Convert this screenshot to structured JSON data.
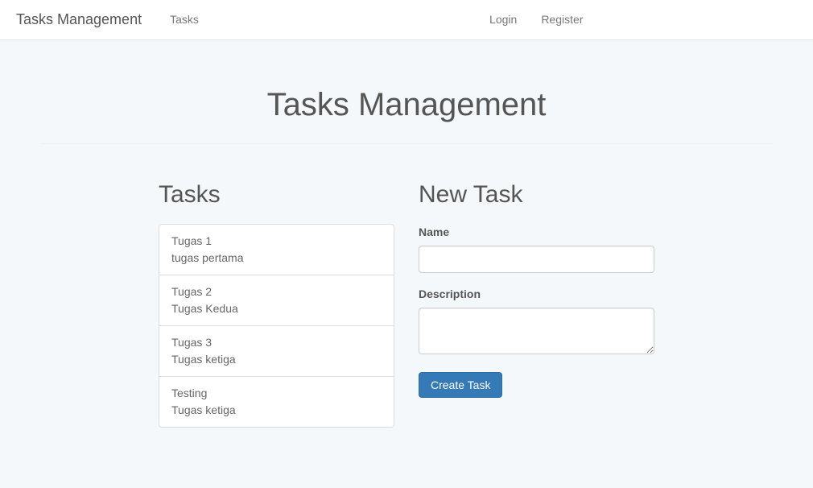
{
  "navbar": {
    "brand": "Tasks Management",
    "left": [
      {
        "label": "Tasks"
      }
    ],
    "right": [
      {
        "label": "Login"
      },
      {
        "label": "Register"
      }
    ]
  },
  "page": {
    "title": "Tasks Management"
  },
  "tasks_section": {
    "heading": "Tasks",
    "items": [
      {
        "name": "Tugas 1",
        "description": "tugas pertama"
      },
      {
        "name": "Tugas 2",
        "description": "Tugas Kedua"
      },
      {
        "name": "Tugas 3",
        "description": "Tugas ketiga"
      },
      {
        "name": "Testing",
        "description": "Tugas ketiga"
      }
    ]
  },
  "new_task_section": {
    "heading": "New Task",
    "name_label": "Name",
    "name_value": "",
    "description_label": "Description",
    "description_value": "",
    "submit_label": "Create Task"
  }
}
